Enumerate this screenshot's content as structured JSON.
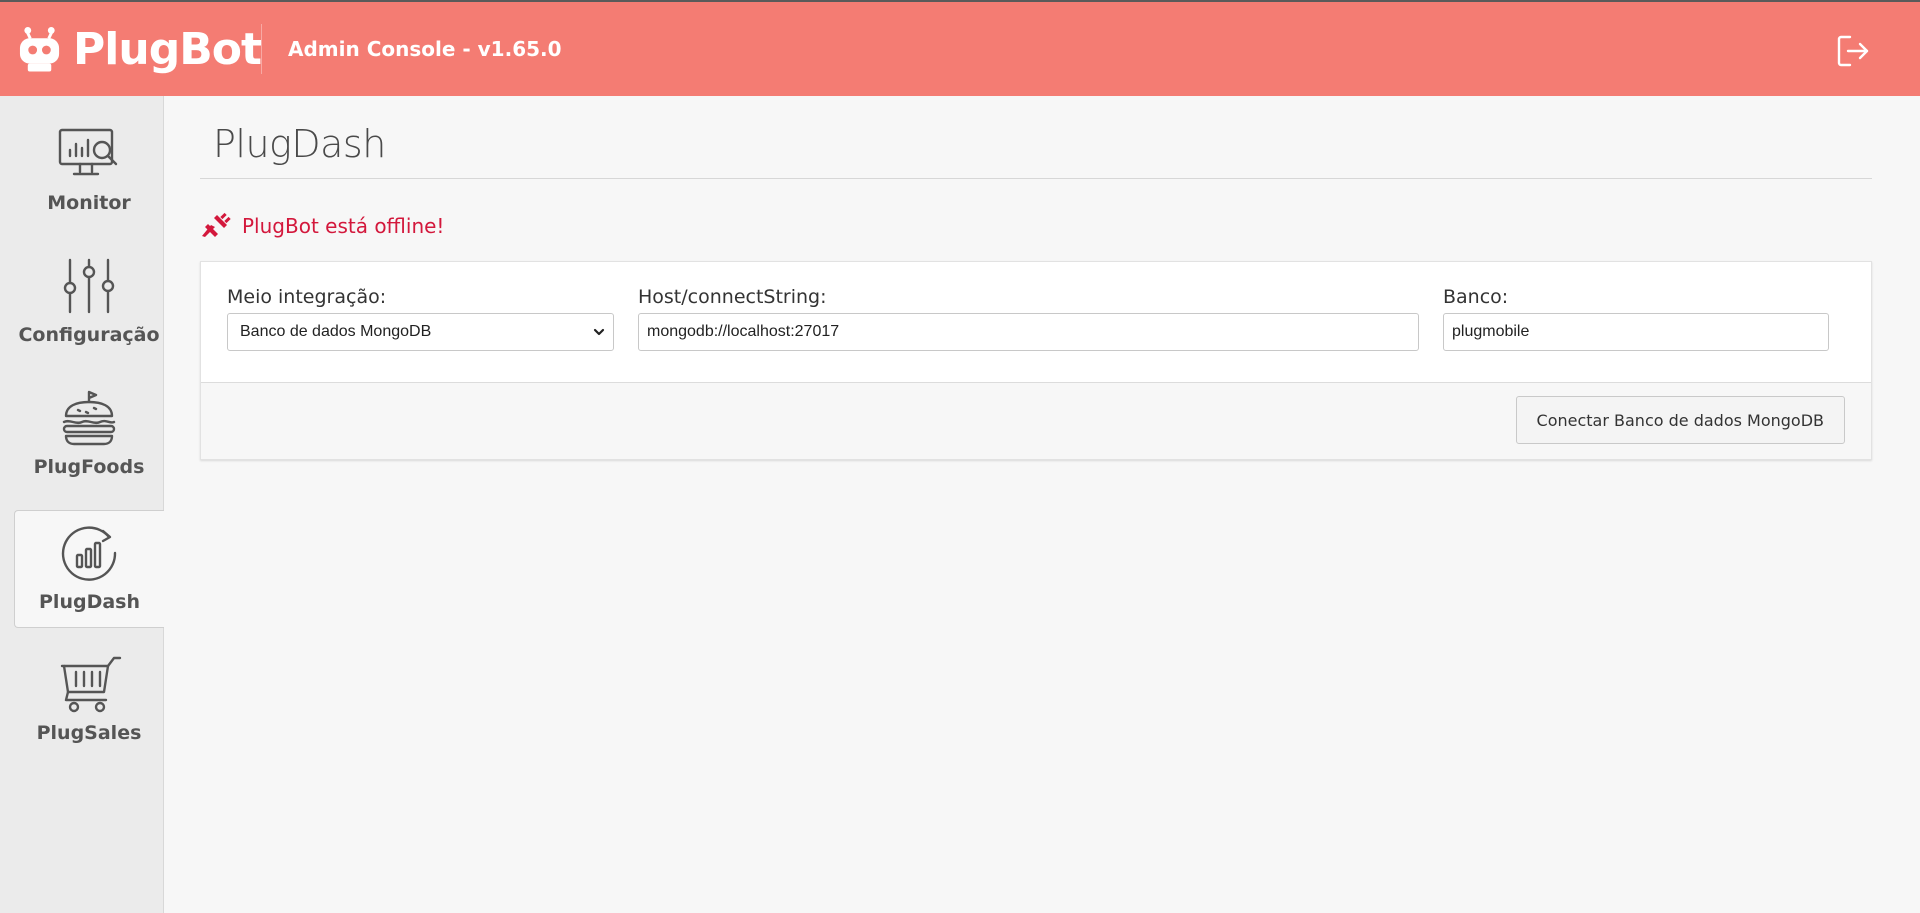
{
  "header": {
    "brand": "PlugBot",
    "title": "Admin Console - v1.65.0"
  },
  "sidebar": {
    "items": [
      {
        "label": "Monitor",
        "icon": "monitor-icon"
      },
      {
        "label": "Configuração",
        "icon": "sliders-icon"
      },
      {
        "label": "PlugFoods",
        "icon": "burger-icon"
      },
      {
        "label": "PlugDash",
        "icon": "chart-refresh-icon",
        "active": true
      },
      {
        "label": "PlugSales",
        "icon": "cart-icon"
      }
    ]
  },
  "main": {
    "title": "PlugDash",
    "status_text": "PlugBot está offline!",
    "form": {
      "integration_label": "Meio integração:",
      "integration_value": "Banco de dados MongoDB",
      "host_label": "Host/connectString:",
      "host_value": "mongodb://localhost:27017",
      "db_label": "Banco:",
      "db_value": "plugmobile"
    },
    "connect_button": "Conectar Banco de dados MongoDB"
  },
  "colors": {
    "header_bg": "#f47c73",
    "status_red": "#d3183c"
  }
}
